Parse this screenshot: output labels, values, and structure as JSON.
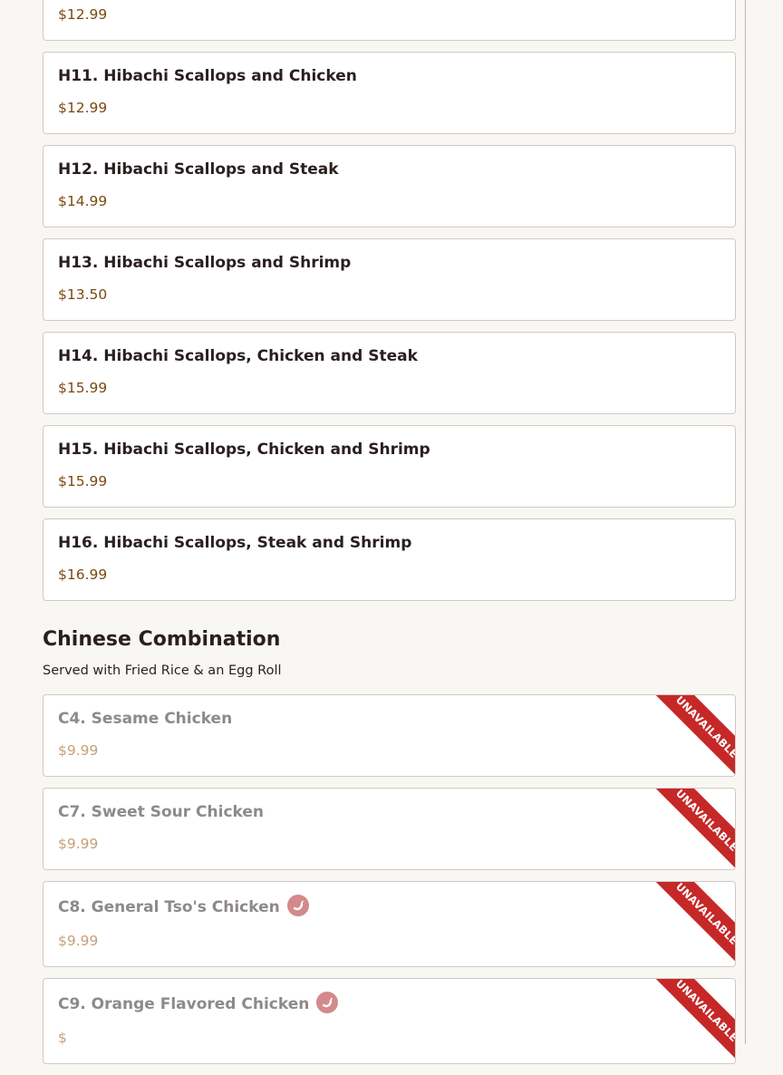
{
  "hibachi_items": [
    {
      "name": "",
      "price": "$12.99"
    },
    {
      "name": "H11. Hibachi Scallops and Chicken",
      "price": "$12.99"
    },
    {
      "name": "H12. Hibachi Scallops and Steak",
      "price": "$14.99"
    },
    {
      "name": "H13. Hibachi Scallops and Shrimp",
      "price": "$13.50"
    },
    {
      "name": "H14. Hibachi Scallops, Chicken and Steak",
      "price": "$15.99"
    },
    {
      "name": "H15. Hibachi Scallops, Chicken and Shrimp",
      "price": "$15.99"
    },
    {
      "name": "H16. Hibachi Scallops, Steak and Shrimp",
      "price": "$16.99"
    }
  ],
  "chinese_section": {
    "title": "Chinese Combination",
    "description": "Served with Fried Rice & an Egg Roll",
    "unavailable_label": "UNAVAILABLE",
    "items": [
      {
        "name": "C4. Sesame Chicken",
        "price": "$9.99",
        "spicy": false
      },
      {
        "name": "C7. Sweet Sour Chicken",
        "price": "$9.99",
        "spicy": false
      },
      {
        "name": "C8. General Tso's Chicken",
        "price": "$9.99",
        "spicy": true,
        "icon": "chili-pepper-icon"
      },
      {
        "name": "C9. Orange Flavored Chicken",
        "price": "$",
        "spicy": true,
        "icon": "chili-pepper-icon"
      }
    ]
  },
  "colors": {
    "background": "#f9f7f4",
    "price": "#7a4a10",
    "ribbon": "#c62828",
    "spicy_badge": "#d38a8a"
  }
}
